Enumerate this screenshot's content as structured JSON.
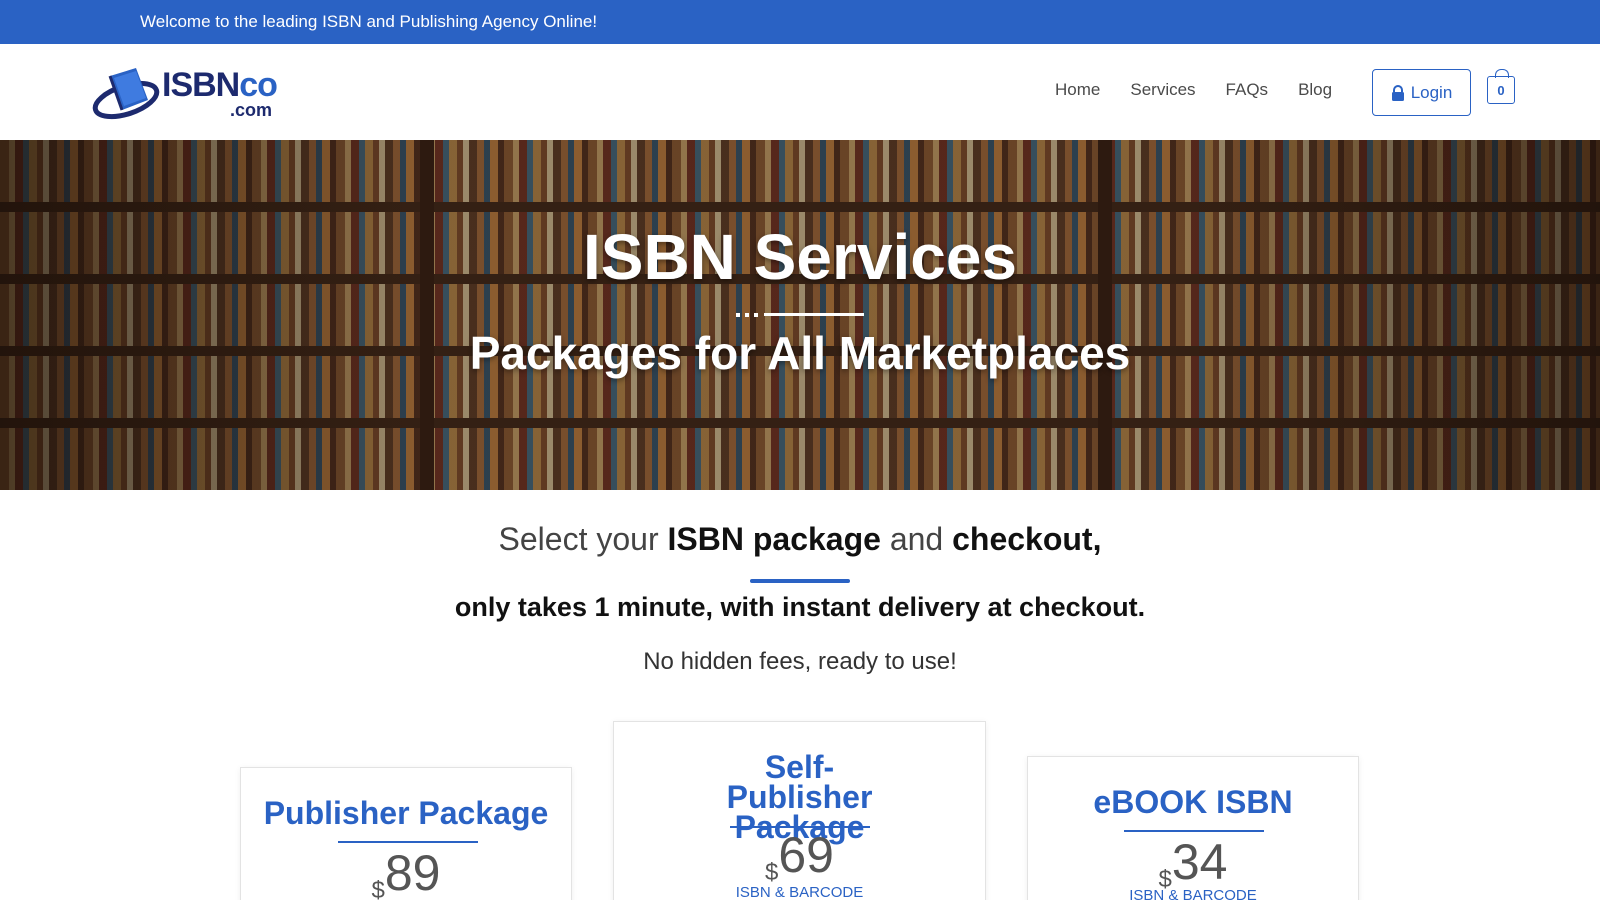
{
  "topbar": {
    "welcome": "Welcome to the leading ISBN and Publishing Agency Online!"
  },
  "header": {
    "logo": {
      "word_main": "ISBN",
      "word_accent": "co",
      "suffix": ".com"
    },
    "nav": [
      "Home",
      "Services",
      "FAQs",
      "Blog"
    ],
    "login_label": "Login",
    "cart_count": "0"
  },
  "hero": {
    "title": "ISBN Services",
    "subtitle": "Packages for All Marketplaces"
  },
  "intro": {
    "line1": {
      "p1": "Select your ",
      "b1": "ISBN package",
      "p2": " and ",
      "b2": "checkout",
      "p3": ","
    },
    "line2": "only takes 1 minute, with instant delivery at checkout.",
    "line3": "No hidden fees, ready to use!"
  },
  "packages": [
    {
      "title": "Publisher Package",
      "currency": "$",
      "price": "89",
      "subtitle": ""
    },
    {
      "title": "Self-Publisher Package",
      "currency": "$",
      "price": "69",
      "subtitle": "ISBN & BARCODE"
    },
    {
      "title": "eBOOK ISBN",
      "currency": "$",
      "price": "34",
      "subtitle": "ISBN & BARCODE"
    }
  ],
  "colors": {
    "brand_blue": "#2a62c4",
    "topbar_bg": "#2a62c4",
    "navy": "#1d2a6e"
  }
}
